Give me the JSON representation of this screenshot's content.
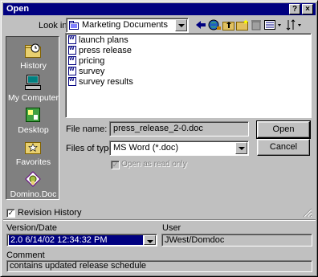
{
  "dialog": {
    "title": "Open"
  },
  "titlebar": {
    "help_label": "?",
    "close_label": "×"
  },
  "lookin": {
    "label": "Look in:",
    "value": "Marketing Documents"
  },
  "places": [
    {
      "label": "History",
      "icon": "history-icon"
    },
    {
      "label": "My Computer",
      "icon": "my-computer-icon"
    },
    {
      "label": "Desktop",
      "icon": "desktop-icon"
    },
    {
      "label": "Favorites",
      "icon": "favorites-icon"
    },
    {
      "label": "Domino.Doc",
      "icon": "domino-doc-icon"
    }
  ],
  "files": [
    "launch plans",
    "press release",
    "pricing",
    "survey",
    "survey results"
  ],
  "filename": {
    "label": "File name:",
    "value": "press_release_2-0.doc"
  },
  "filetype": {
    "label": "Files of type:",
    "value": "MS Word (*.doc)"
  },
  "readonly": {
    "label": "Open as read only"
  },
  "buttons": {
    "open": "Open",
    "cancel": "Cancel"
  },
  "revision": {
    "label": "Revision History",
    "check": "✓"
  },
  "version": {
    "label": "Version/Date",
    "value": "2.0   6/14/02 12:34:32 PM"
  },
  "user": {
    "label": "User",
    "value": "JWest/Domdoc"
  },
  "comment": {
    "label": "Comment",
    "value": "contains updated release schedule"
  },
  "colors": {
    "title_bar": "#000080",
    "selection": "#000080",
    "face": "#c0c0c0",
    "places_bar": "#808080"
  }
}
